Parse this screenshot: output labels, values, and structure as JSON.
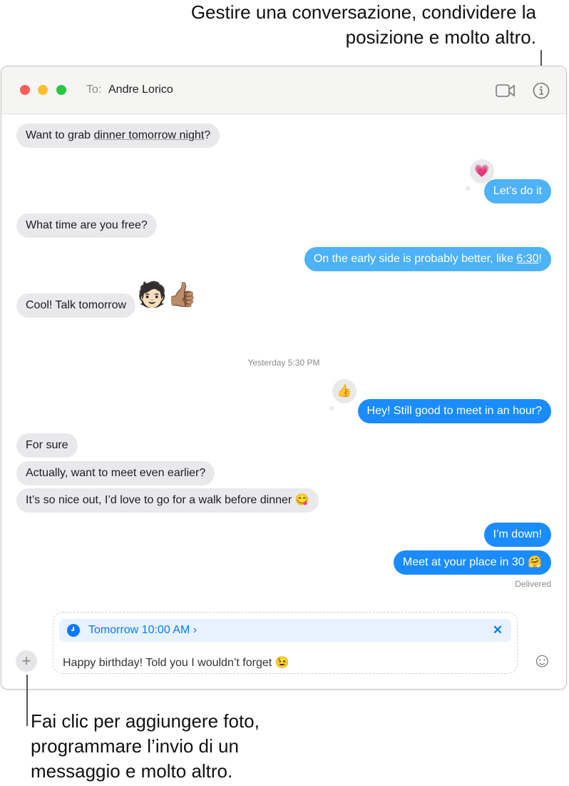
{
  "callouts": {
    "top": [
      "Gestire una conversazione, condividere la",
      "posizione e molto altro."
    ],
    "bottom": [
      "Fai clic per aggiungere foto,",
      "programmare l’invio di un",
      "messaggio e molto altro."
    ]
  },
  "window": {
    "to_label": "To:",
    "recipient": "Andre Lorico",
    "icons": [
      "video-camera-icon",
      "info-icon"
    ]
  },
  "messages": [
    {
      "from": "them",
      "pre": "Want to grab ",
      "link": "dinner tomorrow night",
      "post": "?"
    },
    {
      "from": "me",
      "text": "Let’s do it",
      "tapback": "💗"
    },
    {
      "from": "them",
      "text": "What time are you free?"
    },
    {
      "from": "me",
      "pre": "On the early side is probably better, like ",
      "link": "6:30",
      "post": "!"
    },
    {
      "from": "them",
      "text": "Cool! Talk tomorrow",
      "sticker": "🧑🏻👍🏽"
    },
    {
      "from": "me",
      "text": "Hey! Still good to meet in an hour?",
      "tapback": "👍"
    },
    {
      "from": "them",
      "text": "For sure"
    },
    {
      "from": "them",
      "text": "Actually, want to meet even earlier?"
    },
    {
      "from": "them",
      "text": "It’s so nice out, I’d love to go for a walk before dinner 😋"
    },
    {
      "from": "me",
      "text": "I’m down!"
    },
    {
      "from": "me",
      "text": "Meet at your place in 30 🤗"
    }
  ],
  "timestamp": "Yesterday 5:30 PM",
  "status": "Delivered",
  "composer": {
    "schedule": "Tomorrow 10:00 AM ›",
    "close": "✕",
    "text": "Happy birthday! Told you I wouldn’t forget 😉",
    "plus": "+",
    "emoji_button": "☺"
  },
  "colors": {
    "sent_light": "#4db2f8",
    "sent": "#1a8cff",
    "received": "#e9e9eb",
    "accent": "#0a7aff"
  }
}
